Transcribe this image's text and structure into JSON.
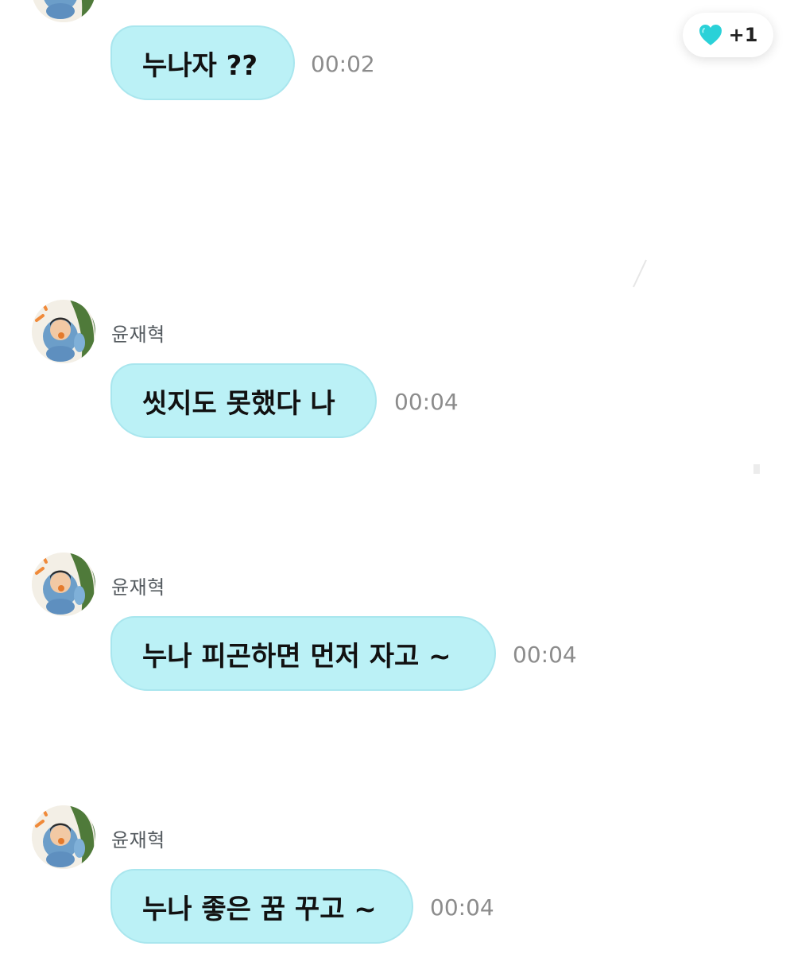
{
  "reaction": {
    "icon": "heart-icon",
    "color": "#2ad1d8",
    "count": "+1"
  },
  "messages": [
    {
      "sender": "",
      "text": "누나자 ??",
      "time": "00:02"
    },
    {
      "sender": "윤재혁",
      "text": "씻지도 못했다 나",
      "time": "00:04"
    },
    {
      "sender": "윤재혁",
      "text": "누나 피곤하면 먼저 자고 ~",
      "time": "00:04"
    },
    {
      "sender": "윤재혁",
      "text": "누나 좋은 꿈 꾸고 ~",
      "time": "00:04"
    }
  ],
  "colors": {
    "bubble": "#bbf1f6",
    "bubble_border": "#a9e6ee",
    "time": "#8c8c8c",
    "sender": "#555b60"
  }
}
